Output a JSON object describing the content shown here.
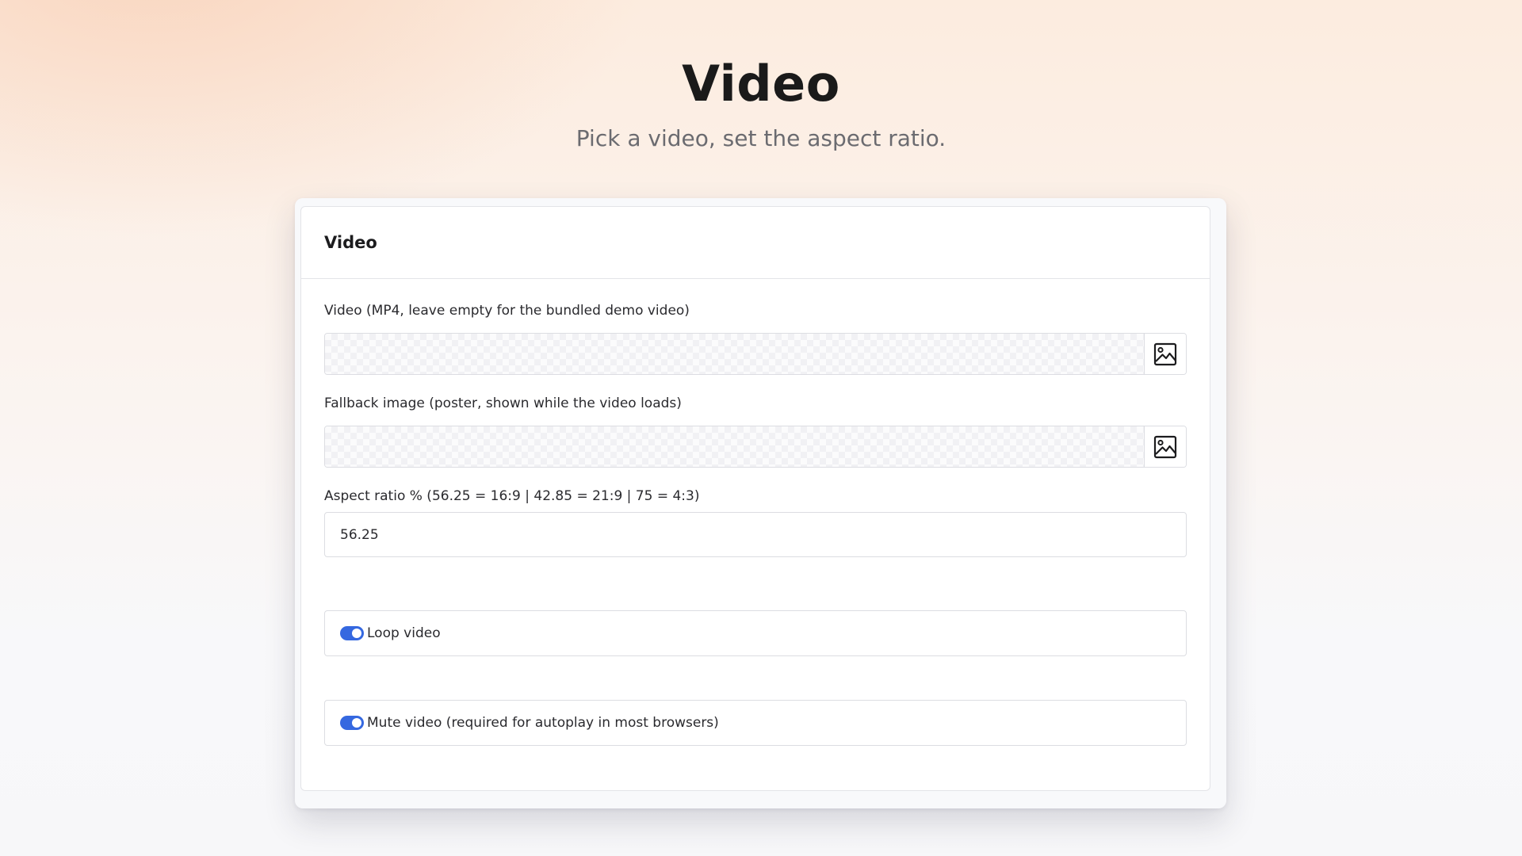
{
  "hero": {
    "title": "Video",
    "subtitle": "Pick a video, set the aspect ratio."
  },
  "card": {
    "title": "Video"
  },
  "fields": {
    "video": {
      "label": "Video (MP4, leave empty for the bundled demo video)",
      "button_icon": "image-icon"
    },
    "fallback": {
      "label": "Fallback image (poster, shown while the video loads)",
      "button_icon": "image-icon"
    },
    "aspect": {
      "label": "Aspect ratio % (56.25 = 16:9 | 42.85 = 21:9 | 75 = 4:3)",
      "value": "56.25"
    },
    "loop": {
      "label": "Loop video",
      "checked": true
    },
    "mute": {
      "label": "Mute video (required for autoplay in most browsers)",
      "checked": true
    }
  },
  "colors": {
    "toggle_accent": "#3568e0",
    "title_text": "#1a1a1a",
    "subtitle_text": "#6b6b70"
  }
}
